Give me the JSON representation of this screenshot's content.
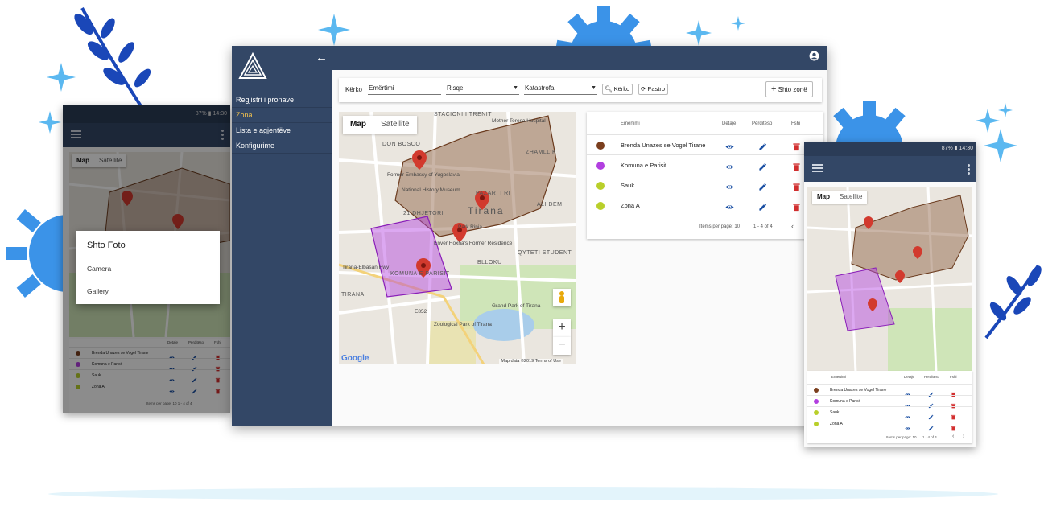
{
  "desktop": {
    "nav": [
      "Regjistri i pronave",
      "Zona",
      "Lista e agjentëve",
      "Konfigurime"
    ],
    "toolbar": {
      "search_label": "Kërko",
      "name_placeholder": "Emërtimi",
      "risk_select": "Risqe",
      "disaster_select": "Katastrofa",
      "search_button": "Kërko",
      "clear_button": "Pastro",
      "add_zone_button": "Shto zonë"
    },
    "map": {
      "tab_map": "Map",
      "tab_satellite": "Satellite",
      "zoom_in": "+",
      "zoom_out": "−",
      "google": "Google",
      "attribution": "Map data ©2019   Terms of Use",
      "labels": {
        "stacioni": "STACIONI I TRENIT",
        "don_bosco": "DON BOSCO",
        "zhamllik": "ZHAMLLIK",
        "teresa": "Mother Teresa Hospital",
        "embassy": "Former Embassy of Yugoslavia",
        "museum": "National History Museum",
        "tirana": "Tirana",
        "pazari": "PAZARI I RI",
        "dhjetori": "21 DHJETORI",
        "ali_demi": "ALI DEMI",
        "park_rinia": "Park Rinia",
        "hoxha": "Enver Hoxha's Former Residence",
        "blloku": "BLLOKU",
        "qyteti": "QYTETI STUDENT",
        "komuna": "KOMUNA E PARISIT",
        "tirana_sm": "TIRANA",
        "grand_park": "Grand Park of Tirana",
        "zoo": "Zoological Park of Tirana",
        "road": "Tirana-Elbasan Hwy",
        "e852": "E852"
      }
    },
    "table": {
      "headers": {
        "name": "Emërtimi",
        "details": "Detaje",
        "edit": "Përditëso",
        "delete": "Fshi"
      },
      "rows": [
        {
          "name": "Brenda Unazes se Vogel Tirane",
          "color": "#7b3f1e"
        },
        {
          "name": "Komuna e Parisit",
          "color": "#b23fe0"
        },
        {
          "name": "Sauk",
          "color": "#b9cf2a"
        },
        {
          "name": "Zona A",
          "color": "#b9cf2a"
        }
      ],
      "items_per_page": "Items per page:  10",
      "range": "1 - 4 of 4"
    }
  },
  "phone_left": {
    "status": "87% ▮ 14:30",
    "map_tab": "Map",
    "satellite_tab": "Satellite",
    "dialog": {
      "title": "Shto Foto",
      "camera": "Camera",
      "gallery": "Gallery"
    },
    "headers": {
      "details": "Detaje",
      "edit": "Përditëso",
      "delete": "Fshi"
    },
    "rows": [
      "Brenda Unazes se Vogel Tirane",
      "Komuna e Parisit",
      "Sauk",
      "Zona A"
    ],
    "pager": "Items per page:  10     1 - 4 of 4"
  },
  "phone_right": {
    "status": "87% ▮ 14:30",
    "map_tab": "Map",
    "satellite_tab": "Satellite",
    "headers": {
      "name": "Emërtimi",
      "details": "Detaje",
      "edit": "Përditëso",
      "delete": "Fshi"
    },
    "rows": [
      "Brenda Unazes se Vogel Tirane",
      "Komuna e Parisit",
      "Sauk",
      "Zona A"
    ],
    "items_per_page": "Items per page:  10",
    "range": "1 - 4 of 4"
  },
  "colors": {
    "nav_bg": "#334766",
    "accent": "#f2c14e",
    "icon_blue": "#1a4fa3",
    "delete_red": "#d32f2f"
  }
}
